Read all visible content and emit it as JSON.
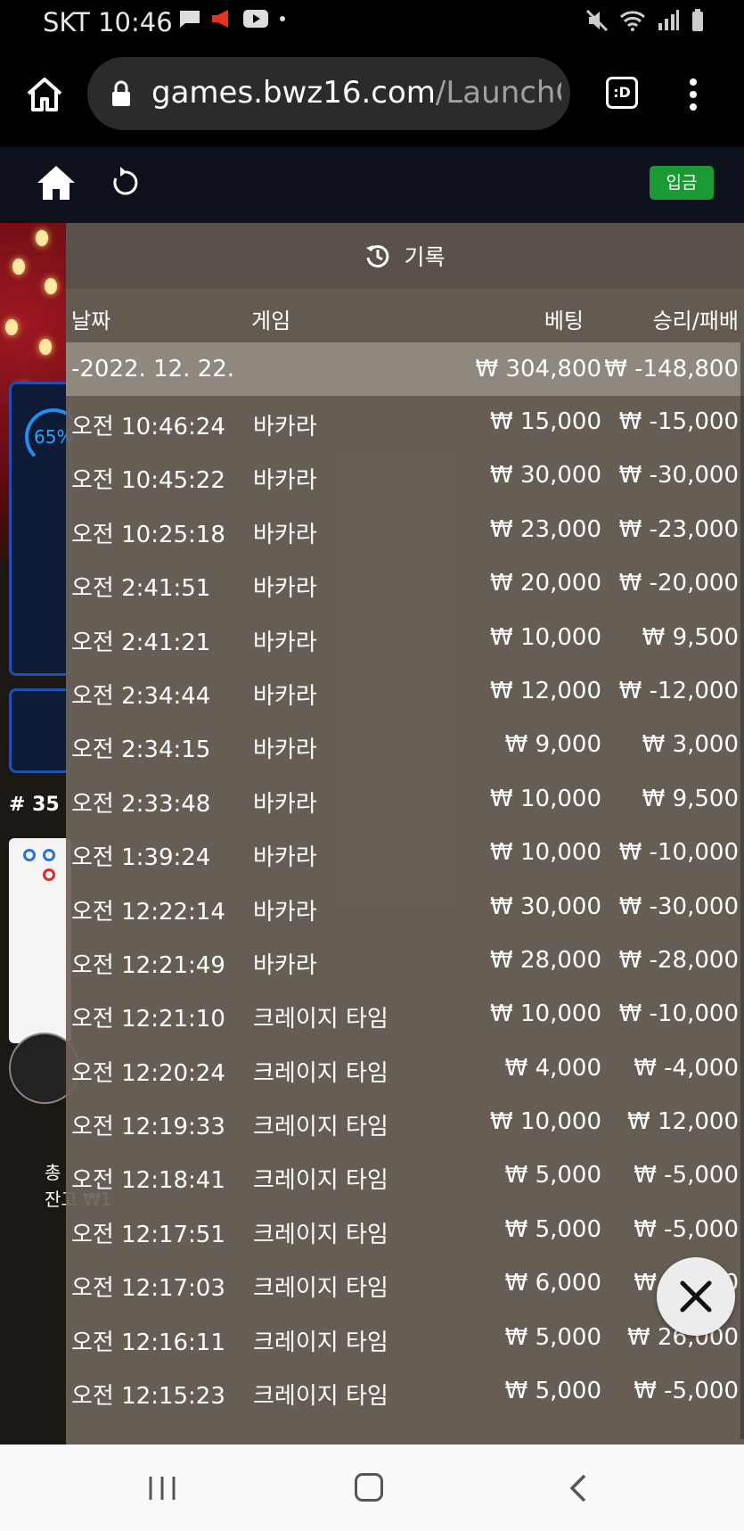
{
  "status": {
    "time": "SKT 10:46"
  },
  "browser": {
    "url_host": "games.bwz16.com",
    "url_rest": "/LaunchG",
    "tab_label": ":D"
  },
  "app": {
    "deposit_label": "입금"
  },
  "background": {
    "progress_percent": "65%",
    "round_label": "# 35",
    "balance_line1": "총",
    "balance_line2": "잔고 ₩1"
  },
  "history": {
    "title": "기록",
    "columns": {
      "date": "날짜",
      "game": "게임",
      "bet": "베팅",
      "winloss": "승리/패배"
    },
    "summary": {
      "date": "-2022. 12. 22.",
      "bet": "₩ 304,800",
      "winloss": "₩ -148,800"
    },
    "rows": [
      {
        "time": "오전 10:46:24",
        "game": "바카라",
        "bet": "₩ 15,000",
        "winloss": "₩ -15,000"
      },
      {
        "time": "오전 10:45:22",
        "game": "바카라",
        "bet": "₩ 30,000",
        "winloss": "₩ -30,000"
      },
      {
        "time": "오전 10:25:18",
        "game": "바카라",
        "bet": "₩ 23,000",
        "winloss": "₩ -23,000"
      },
      {
        "time": "오전 2:41:51",
        "game": "바카라",
        "bet": "₩ 20,000",
        "winloss": "₩ -20,000"
      },
      {
        "time": "오전 2:41:21",
        "game": "바카라",
        "bet": "₩ 10,000",
        "winloss": "₩ 9,500"
      },
      {
        "time": "오전 2:34:44",
        "game": "바카라",
        "bet": "₩ 12,000",
        "winloss": "₩ -12,000"
      },
      {
        "time": "오전 2:34:15",
        "game": "바카라",
        "bet": "₩ 9,000",
        "winloss": "₩ 3,000"
      },
      {
        "time": "오전 2:33:48",
        "game": "바카라",
        "bet": "₩ 10,000",
        "winloss": "₩ 9,500"
      },
      {
        "time": "오전 1:39:24",
        "game": "바카라",
        "bet": "₩ 10,000",
        "winloss": "₩ -10,000"
      },
      {
        "time": "오전 12:22:14",
        "game": "바카라",
        "bet": "₩ 30,000",
        "winloss": "₩ -30,000"
      },
      {
        "time": "오전 12:21:49",
        "game": "바카라",
        "bet": "₩ 28,000",
        "winloss": "₩ -28,000"
      },
      {
        "time": "오전 12:21:10",
        "game": "크레이지 타임",
        "bet": "₩ 10,000",
        "winloss": "₩ -10,000"
      },
      {
        "time": "오전 12:20:24",
        "game": "크레이지 타임",
        "bet": "₩ 4,000",
        "winloss": "₩ -4,000"
      },
      {
        "time": "오전 12:19:33",
        "game": "크레이지 타임",
        "bet": "₩ 10,000",
        "winloss": "₩ 12,000"
      },
      {
        "time": "오전 12:18:41",
        "game": "크레이지 타임",
        "bet": "₩ 5,000",
        "winloss": "₩ -5,000"
      },
      {
        "time": "오전 12:17:51",
        "game": "크레이지 타임",
        "bet": "₩ 5,000",
        "winloss": "₩ -5,000"
      },
      {
        "time": "오전 12:17:03",
        "game": "크레이지 타임",
        "bet": "₩ 6,000",
        "winloss": "₩ -6,000"
      },
      {
        "time": "오전 12:16:11",
        "game": "크레이지 타임",
        "bet": "₩ 5,000",
        "winloss": "₩ 26,000"
      },
      {
        "time": "오전 12:15:23",
        "game": "크레이지 타임",
        "bet": "₩ 5,000",
        "winloss": "₩ -5,000"
      }
    ]
  },
  "colors": {
    "deposit": "#1a9a32",
    "overlay": "#6c645a",
    "accent_blue": "#1f8ff0"
  }
}
